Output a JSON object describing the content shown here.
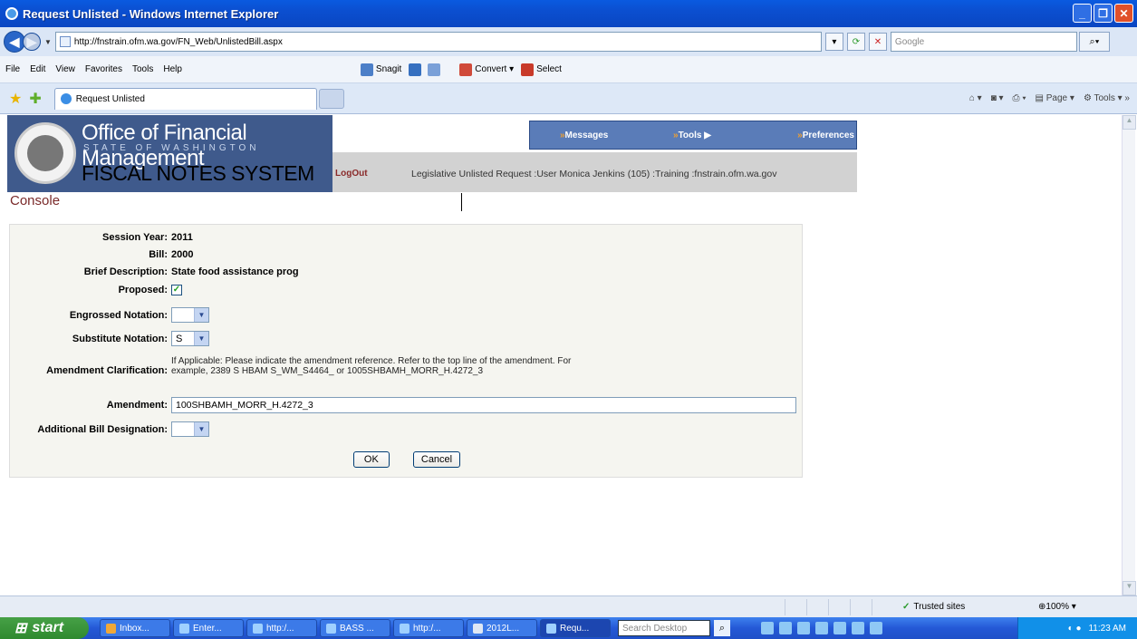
{
  "window": {
    "title": "Request Unlisted - Windows Internet Explorer"
  },
  "address": {
    "url": "http://fnstrain.ofm.wa.gov/FN_Web/UnlistedBill.aspx",
    "search_placeholder": "Google"
  },
  "menu": {
    "items": [
      "File",
      "Edit",
      "View",
      "Favorites",
      "Tools",
      "Help"
    ],
    "snagit": "Snagit",
    "convert": "Convert",
    "select": "Select"
  },
  "tabs": {
    "active": "Request Unlisted"
  },
  "commandbar": {
    "page": "Page",
    "tools": "Tools"
  },
  "header": {
    "org": "Office of Financial Management",
    "state": "STATE OF WASHINGTON",
    "system": "FISCAL NOTES SYSTEM",
    "logout": "LogOut",
    "user_info": "Legislative Unlisted Request :User Monica Jenkins (105) :Training :fnstrain.ofm.wa.gov",
    "nav": {
      "messages": "Messages",
      "tools": "Tools",
      "preferences": "Preferences"
    }
  },
  "page": {
    "section": "Console"
  },
  "form": {
    "session_year_label": "Session Year:",
    "session_year": "2011",
    "bill_label": "Bill:",
    "bill": "2000",
    "brief_label": "Brief Description:",
    "brief": "State food assistance prog",
    "proposed_label": "Proposed:",
    "engrossed_label": "Engrossed Notation:",
    "engrossed": "",
    "substitute_label": "Substitute Notation:",
    "substitute": "S",
    "amend_clar_label": "Amendment Clarification:",
    "amend_clar_note": "If Applicable: Please indicate the amendment reference. Refer to the top line of the amendment. For example, 2389 S HBAM S_WM_S4464_ or 1005SHBAMH_MORR_H.4272_3",
    "amendment_label": "Amendment:",
    "amendment": "100SHBAMH_MORR_H.4272_3",
    "additional_label": "Additional Bill Designation:",
    "additional": "",
    "ok": "OK",
    "cancel": "Cancel"
  },
  "status": {
    "zone": "Trusted sites",
    "zoom": "100%"
  },
  "taskbar": {
    "start": "start",
    "tasks": [
      "Inbox...",
      "Enter...",
      "http:/...",
      "BASS ...",
      "http:/...",
      "2012L...",
      "Requ..."
    ],
    "search": "Search Desktop",
    "time": "11:23 AM"
  }
}
